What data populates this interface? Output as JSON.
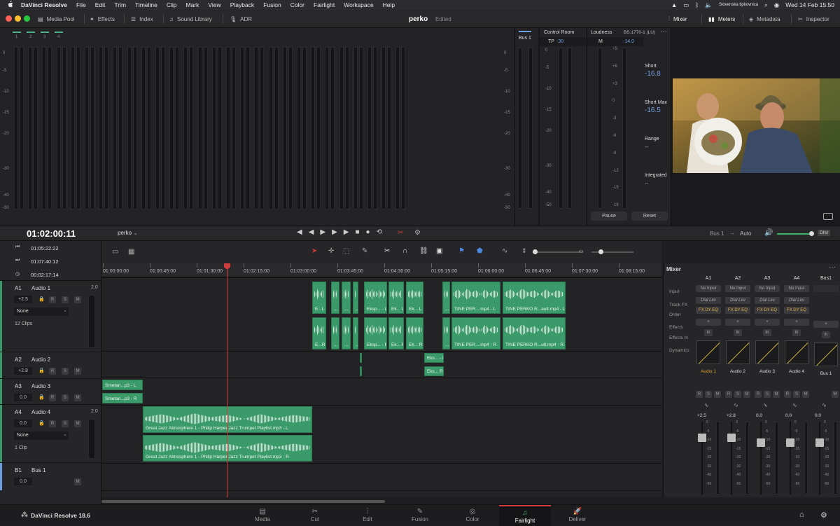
{
  "menubar": {
    "app": "DaVinci Resolve",
    "items": [
      "File",
      "Edit",
      "Trim",
      "Timeline",
      "Clip",
      "Mark",
      "View",
      "Playback",
      "Fusion",
      "Color",
      "Fairlight",
      "Workspace",
      "Help"
    ],
    "keyboard": "Slovenska tipkovnica",
    "datetime": "Wed 14 Feb  15:50"
  },
  "toolbar": {
    "media_pool": "Media Pool",
    "effects": "Effects",
    "index": "Index",
    "sound_library": "Sound Library",
    "adr": "ADR",
    "project_name": "perko",
    "project_status": "Edited",
    "mixer": "Mixer",
    "meters": "Meters",
    "metadata": "Metadata",
    "inspector": "Inspector"
  },
  "meters": {
    "channels": [
      "1",
      "2",
      "3",
      "4"
    ],
    "scale": [
      "0",
      "-5",
      "-10",
      "-15",
      "-20",
      "-30",
      "-40",
      "-50"
    ]
  },
  "bus_panel": {
    "title": "Bus 1",
    "scale": [
      "0",
      "-5",
      "-10",
      "-15",
      "-20",
      "-30",
      "-40",
      "-50"
    ]
  },
  "control_room": {
    "title": "Control Room",
    "tp_label": "TP",
    "tp_value": "-30",
    "scale": [
      "0",
      "-5",
      "-10",
      "-15",
      "-20",
      "-30",
      "-40",
      "-50"
    ]
  },
  "loudness": {
    "title": "Loudness",
    "standard": "BS.1770-1 (LU)",
    "m_label": "M",
    "m_value": "-14.0",
    "scale": [
      "+5",
      "+6",
      "+3",
      "0",
      "-3",
      "-6",
      "-9",
      "-12",
      "-15",
      "-18"
    ],
    "short_label": "Short",
    "short_value": "-16.8",
    "short_max_label": "Short Max",
    "short_max_value": "-16.5",
    "range_label": "Range",
    "range_value": "--",
    "integrated_label": "Integrated",
    "integrated_value": "--",
    "pause": "Pause",
    "reset": "Reset"
  },
  "transport": {
    "timecode": "01:02:00:11",
    "timeline_name": "perko",
    "bus_out": "Bus 1",
    "auto": "Auto",
    "dim": "DIM"
  },
  "timecodes": {
    "t1": "01:05:22:22",
    "t2": "01:07:40:12",
    "t3": "00:02:17:14"
  },
  "ruler": [
    "01:00:00:00",
    "01:00:45:00",
    "01:01:30:00",
    "01:02:15:00",
    "01:03:00:00",
    "01:03:45:00",
    "01:04:30:00",
    "01:05:15:00",
    "01:06:00:00",
    "01:06:45:00",
    "01:07:30:00",
    "01:08:15:00"
  ],
  "tracks": [
    {
      "id": "A1",
      "name": "Audio 1",
      "fmt": "2.0",
      "vol": "+2.5",
      "effect": "None",
      "clips": "12 Clips"
    },
    {
      "id": "A2",
      "name": "Audio 2",
      "fmt": "",
      "vol": "+2.8",
      "effect": "",
      "clips": ""
    },
    {
      "id": "A3",
      "name": "Audio 3",
      "fmt": "",
      "vol": "0.0",
      "effect": "",
      "clips": ""
    },
    {
      "id": "A4",
      "name": "Audio 4",
      "fmt": "2.0",
      "vol": "0.0",
      "effect": "None",
      "clips": "1 Clip"
    },
    {
      "id": "B1",
      "name": "Bus 1",
      "fmt": "",
      "vol": "0.0",
      "effect": "",
      "clips": ""
    }
  ],
  "track_buttons": {
    "r": "R",
    "s": "S",
    "m": "M"
  },
  "clips": {
    "a1_top": [
      "E...L",
      "...",
      "Eksp... - L",
      "Ek... L",
      "Ek... L",
      "TINE PER....mp4 - L",
      "TINE PERKO R...ault.mp4 - L"
    ],
    "a1_bot": [
      "E...R",
      "...",
      "Eksp... - R",
      "Ek... R",
      "Ek... R",
      "TINE PER....mp4 - R",
      "TINE PERKO R...ult.mp4 - R"
    ],
    "a2": [
      "Eks... - L",
      "Eks... R"
    ],
    "a3": [
      "Smetan...p3 - L",
      "Smetan...p3 - R"
    ],
    "a4": [
      "Great Jazz Atmosphere 1 - Philip Harper Jazz Trumpet Playlist.mp3 - L",
      "Great Jazz Atmosphere 1 - Philip Harper Jazz Trumpet Playlist.mp3 - R"
    ]
  },
  "mixer": {
    "title": "Mixer",
    "columns": [
      "A1",
      "A2",
      "A3",
      "A4",
      "Bus1"
    ],
    "row_labels": [
      "Input",
      "Track FX",
      "Order",
      "Effects",
      "Effects In",
      "Dynamics"
    ],
    "input": "No Input",
    "track_fx": "Dial Lev",
    "order": "FX DY EQ",
    "effects_in": "In",
    "names": [
      "Audio 1",
      "Audio 2",
      "Audio 3",
      "Audio 4",
      "Bus 1"
    ],
    "values": [
      "+2.5",
      "+2.8",
      "0.0",
      "0.0",
      "0.0"
    ],
    "fader_scale": [
      "0",
      "-5",
      "-10",
      "-15",
      "-20",
      "-30",
      "-40",
      "-50"
    ]
  },
  "footer": {
    "brand": "DaVinci Resolve 18.6",
    "pages": [
      "Media",
      "Cut",
      "Edit",
      "Fusion",
      "Color",
      "Fairlight",
      "Deliver"
    ],
    "active_page": "Fairlight"
  },
  "colors": {
    "accent_red": "#d13c3c",
    "clip_green": "#3a9a6a",
    "meter_green": "#4fb08e",
    "value_blue": "#6f9fe0"
  }
}
